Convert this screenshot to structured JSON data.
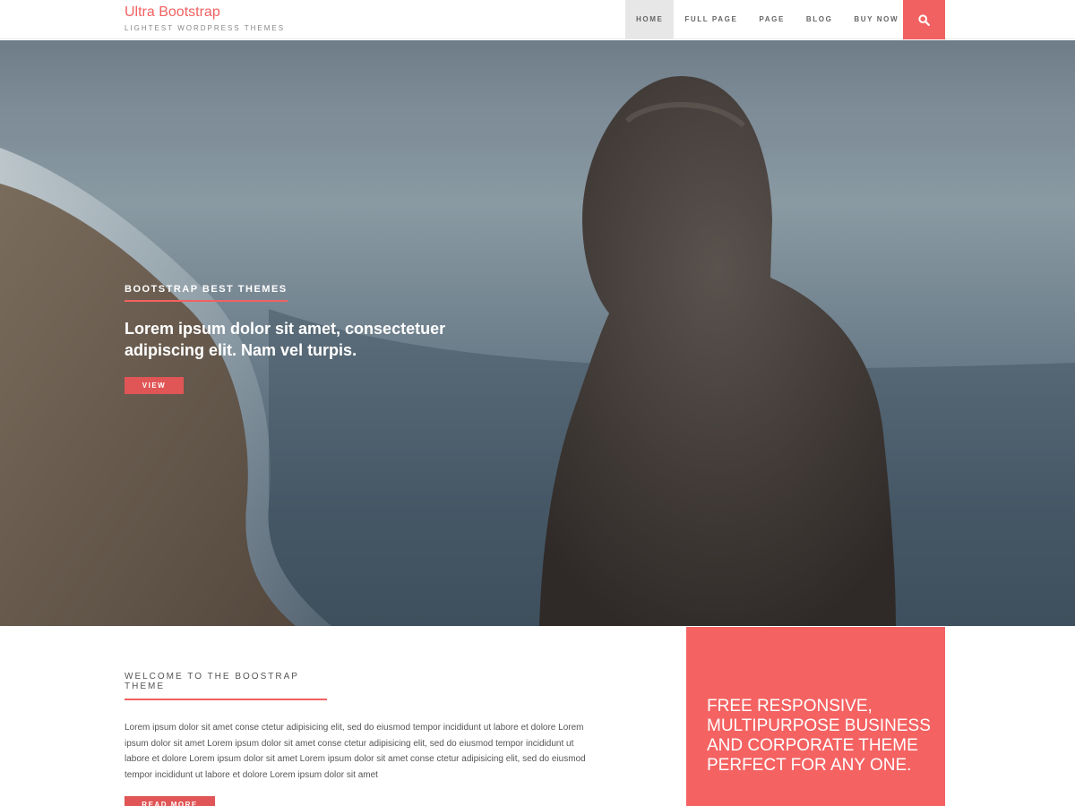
{
  "header": {
    "brand_title": "Ultra Bootstrap",
    "brand_tagline": "LIGHTEST WORDPRESS THEMES",
    "nav": [
      {
        "label": "HOME",
        "active": true
      },
      {
        "label": "FULL PAGE"
      },
      {
        "label": "PAGE"
      },
      {
        "label": "BLOG"
      },
      {
        "label": "BUY NOW"
      }
    ],
    "search_icon": "search-icon"
  },
  "hero": {
    "kicker": "BOOTSTRAP BEST THEMES",
    "text": "Lorem ipsum dolor sit amet, consectetuer adipiscing elit. Nam vel turpis.",
    "button_label": "VIEW"
  },
  "welcome": {
    "title": "WELCOME TO THE BOOSTRAP THEME",
    "text": "Lorem ipsum dolor sit amet conse ctetur adipisicing elit, sed do eiusmod tempor incididunt ut labore et dolore Lorem ipsum dolor sit amet Lorem ipsum dolor sit amet conse ctetur adipisicing elit, sed do eiusmod tempor incididunt ut labore et dolore Lorem ipsum dolor sit amet Lorem ipsum dolor sit amet conse ctetur adipisicing elit, sed do eiusmod tempor incididunt ut labore et dolore Lorem ipsum dolor sit amet",
    "button_label": "READ MORE"
  },
  "promo": {
    "text": "FREE RESPONSIVE, MULTIPURPOSE BUSINESS AND CORPORATE THEME PERFECT FOR ANY ONE."
  },
  "colors": {
    "accent": "#f26161",
    "button": "#e05555",
    "promo_bg": "#f56262"
  }
}
